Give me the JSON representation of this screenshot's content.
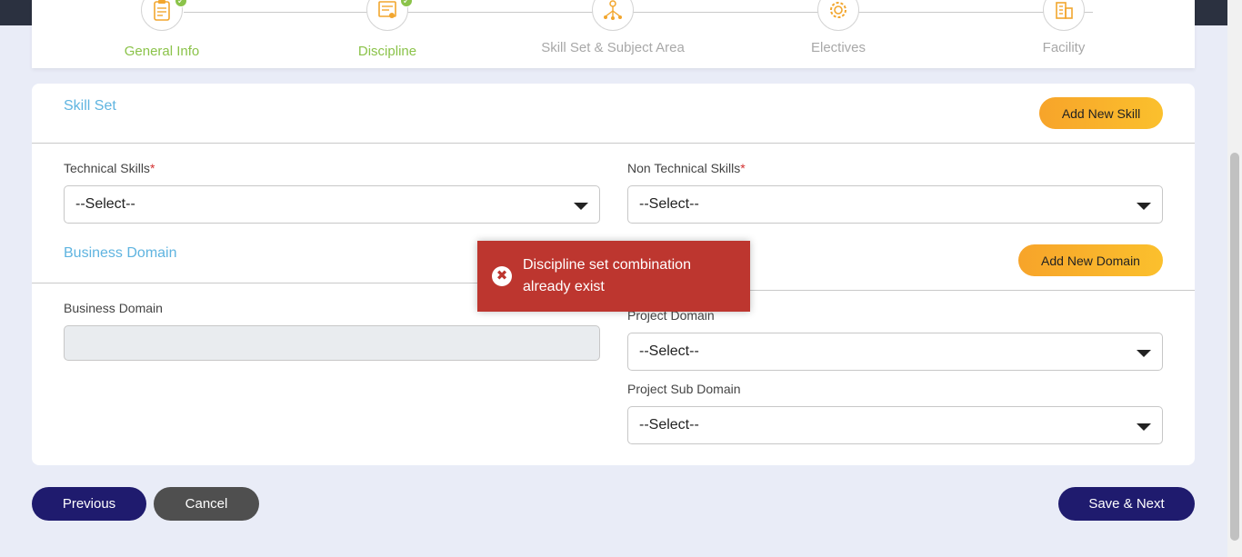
{
  "stepper": {
    "steps": [
      {
        "label": "General Info",
        "icon": "clipboard-icon",
        "done": true
      },
      {
        "label": "Discipline",
        "icon": "certificate-icon",
        "done": true
      },
      {
        "label": "Skill Set & Subject Area",
        "icon": "network-icon",
        "done": false
      },
      {
        "label": "Electives",
        "icon": "gear-icon",
        "done": false
      },
      {
        "label": "Facility",
        "icon": "building-icon",
        "done": false
      }
    ],
    "check_glyph": "✓"
  },
  "skill_set": {
    "title": "Skill Set",
    "add_button": "Add New Skill",
    "technical_label": "Technical Skills",
    "non_technical_label": "Non Technical Skills",
    "required_mark": "*",
    "technical_value": "--Select--",
    "non_technical_value": "--Select--"
  },
  "business": {
    "title": "Business Domain",
    "add_button": "Add New Domain",
    "business_domain_label": "Business Domain",
    "business_domain_value": "",
    "project_domain_label": "Project Domain",
    "project_domain_value": "--Select--",
    "project_sub_domain_label": "Project Sub Domain",
    "project_sub_domain_value": "--Select--"
  },
  "toast": {
    "message": "Discipline set combination already exist",
    "icon_glyph": "✖"
  },
  "footer": {
    "previous": "Previous",
    "cancel": "Cancel",
    "save_next": "Save & Next"
  },
  "colors": {
    "accent_blue": "#5fb4e0",
    "done_green": "#8bc34a",
    "navy": "#1f1b6e",
    "toast_red": "#bd362f",
    "orange": "#f7a42a"
  }
}
